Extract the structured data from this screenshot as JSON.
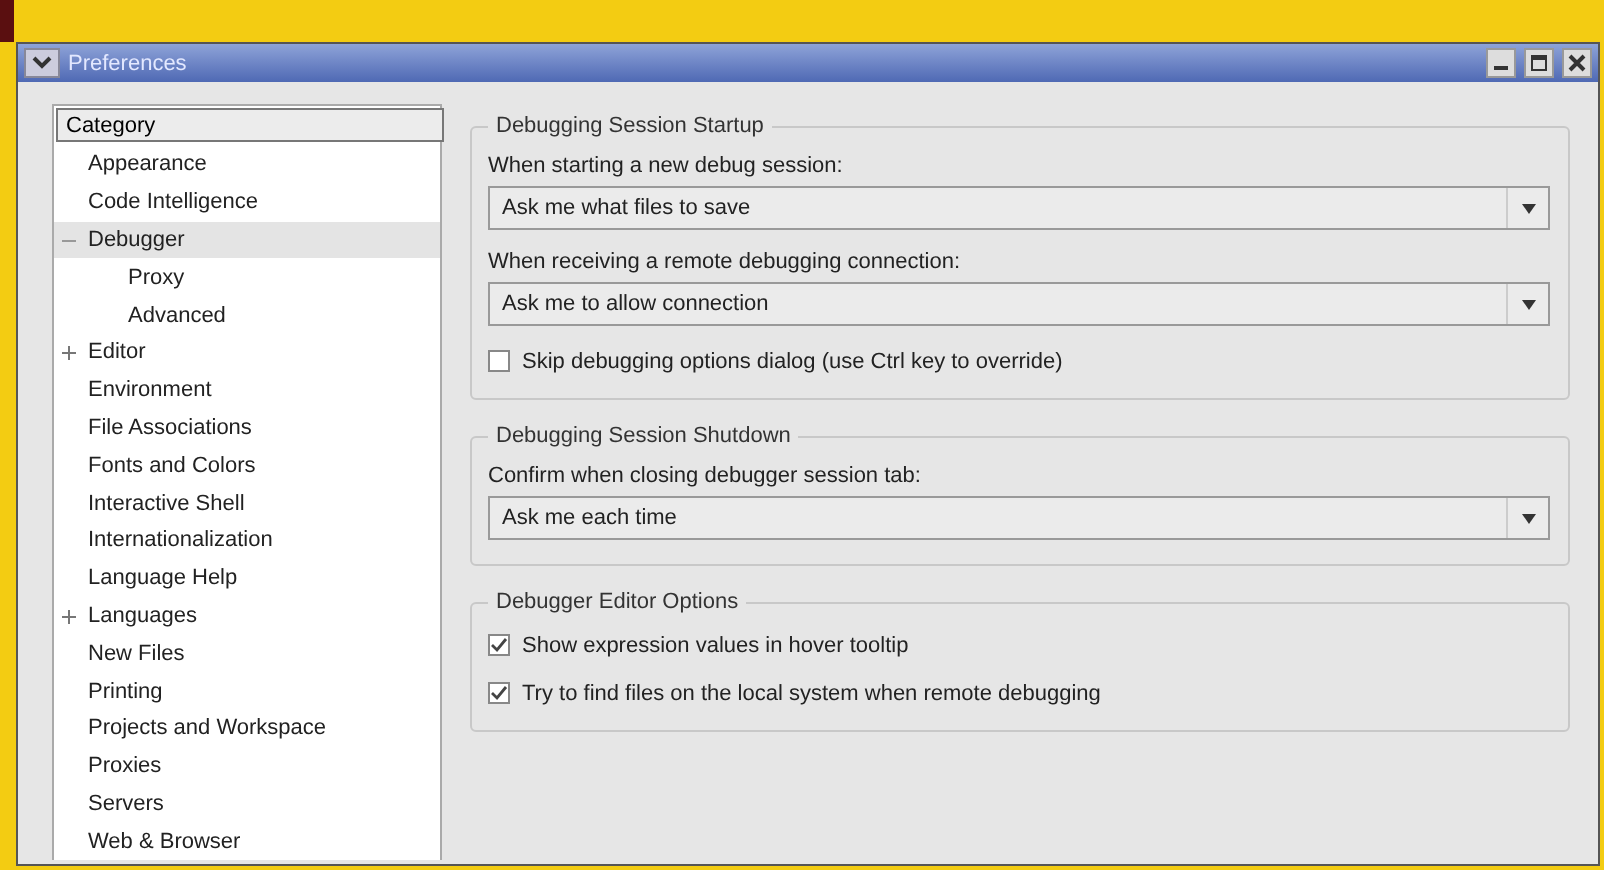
{
  "window": {
    "title": "Preferences"
  },
  "sidebar": {
    "header": "Category",
    "items": [
      {
        "label": "Appearance",
        "selected": false
      },
      {
        "label": "Code Intelligence",
        "selected": false
      },
      {
        "label": "Debugger",
        "selected": true,
        "expanded": true,
        "children": [
          {
            "label": "Proxy",
            "selected": false
          },
          {
            "label": "Advanced",
            "selected": false
          }
        ]
      },
      {
        "label": "Editor",
        "selected": false,
        "expanded": false
      },
      {
        "label": "Environment",
        "selected": false
      },
      {
        "label": "File Associations",
        "selected": false
      },
      {
        "label": "Fonts and Colors",
        "selected": false
      },
      {
        "label": "Interactive Shell",
        "selected": false
      },
      {
        "label": "Internationalization",
        "selected": false
      },
      {
        "label": "Language Help",
        "selected": false
      },
      {
        "label": "Languages",
        "selected": false,
        "expanded": false
      },
      {
        "label": "New Files",
        "selected": false
      },
      {
        "label": "Printing",
        "selected": false
      },
      {
        "label": "Projects and Workspace",
        "selected": false
      },
      {
        "label": "Proxies",
        "selected": false
      },
      {
        "label": "Servers",
        "selected": false
      },
      {
        "label": "Web & Browser",
        "selected": false
      }
    ]
  },
  "groups": [
    {
      "title": "Debugging Session Startup",
      "controls": [
        {
          "kind": "label",
          "text": "When starting a new debug session:"
        },
        {
          "kind": "dropdown",
          "value": "Ask me what files to save"
        },
        {
          "kind": "label",
          "text": "When receiving a remote debugging connection:"
        },
        {
          "kind": "dropdown",
          "value": "Ask me to allow connection"
        },
        {
          "kind": "checkbox",
          "label": "Skip debugging options dialog (use Ctrl key to override)",
          "checked": false
        }
      ]
    },
    {
      "title": "Debugging Session Shutdown",
      "controls": [
        {
          "kind": "label",
          "text": "Confirm when closing debugger session tab:"
        },
        {
          "kind": "dropdown",
          "value": "Ask me each time"
        }
      ]
    },
    {
      "title": "Debugger Editor Options",
      "controls": [
        {
          "kind": "checkbox",
          "label": "Show expression values in hover tooltip",
          "checked": true
        },
        {
          "kind": "checkbox",
          "label": "Try to find files on the local system when remote debugging",
          "checked": true
        }
      ]
    }
  ]
}
